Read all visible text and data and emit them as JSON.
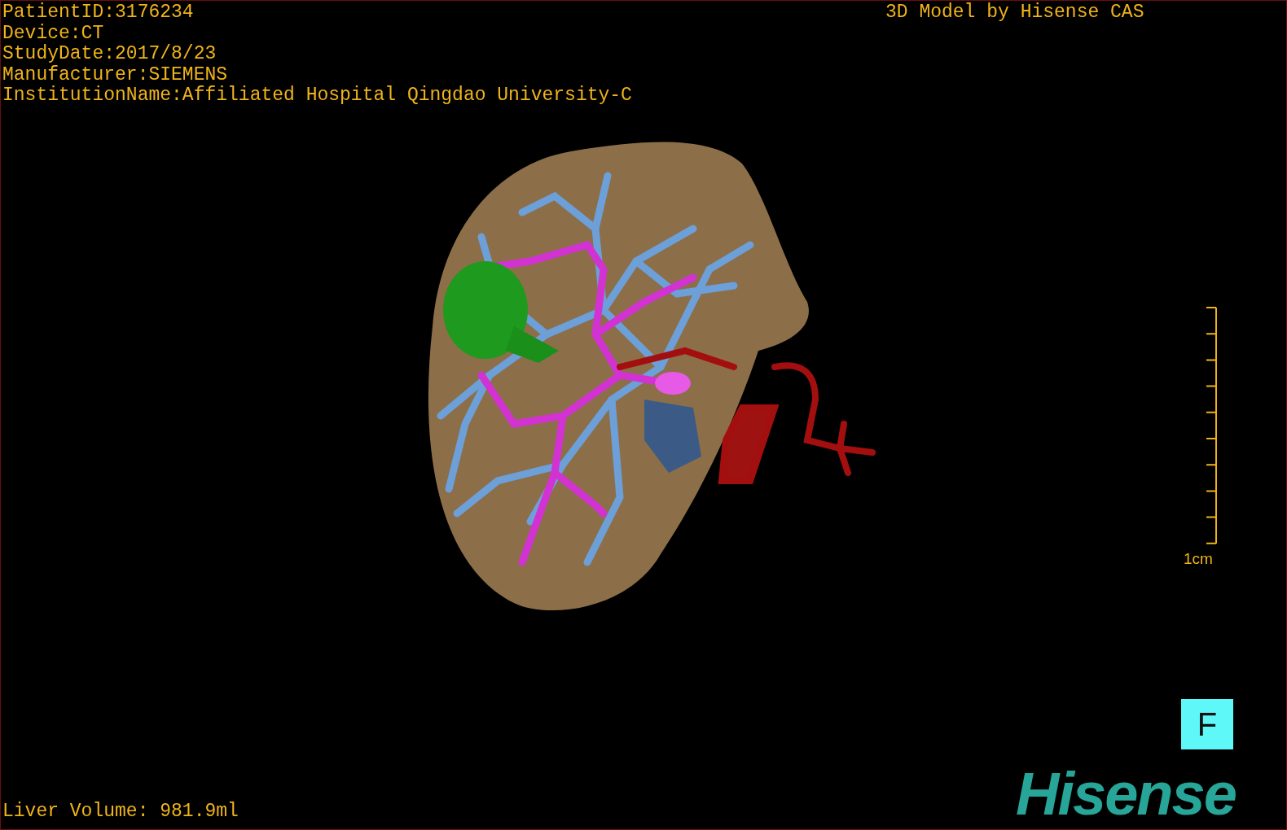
{
  "patient_info": [
    {
      "text": "PatientID:3176234"
    },
    {
      "text": "Device:CT"
    },
    {
      "text": "StudyDate:2017/8/23"
    },
    {
      "text": "Manufacturer:SIEMENS"
    },
    {
      "text": "InstitutionName:Affiliated Hospital Qingdao University-C"
    }
  ],
  "caption": "3D Model by Hisense CAS",
  "scale_bar": {
    "label": "1cm"
  },
  "orientation_marker": "F",
  "liver_volume": "Liver Volume: 981.9ml",
  "logo": "Hisense"
}
